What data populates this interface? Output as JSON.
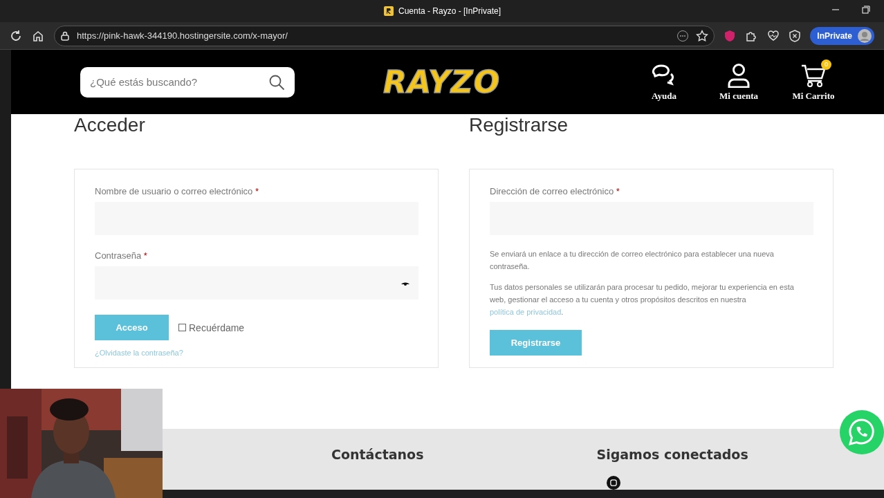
{
  "browser": {
    "tab_title": "Cuenta - Rayzo - [InPrivate]",
    "url": "https://pink-hawk-344190.hostingersite.com/x-mayor/",
    "profile_label": "InPrivate"
  },
  "header": {
    "search_placeholder": "¿Qué estás buscando?",
    "logo": "RAYZO",
    "nav": [
      {
        "label": "Ayuda",
        "kind": "chat"
      },
      {
        "label": "Mi cuenta",
        "kind": "user"
      },
      {
        "label": "Mi Carrito",
        "kind": "cart",
        "badge": "0"
      }
    ]
  },
  "login": {
    "title": "Acceder",
    "fields": [
      {
        "label": "Nombre de usuario o correo electrónico",
        "required_mark": "*",
        "kind": "text"
      },
      {
        "label": "Contraseña",
        "required_mark": "*",
        "kind": "password"
      }
    ],
    "button": "Acceso",
    "remember": {
      "label": "Recuérdame",
      "checked": false
    },
    "lost_password": "¿Olvidaste la contraseña?"
  },
  "register": {
    "title": "Registrarse",
    "fields": [
      {
        "label": "Dirección de correo electrónico",
        "required_mark": "*"
      }
    ],
    "notice": "Se enviará un enlace a tu dirección de correo electrónico para establecer una nueva contraseña.",
    "privacy_text": "Tus datos personales se utilizarán para procesar tu pedido, mejorar tu experiencia en esta web, gestionar el acceso a tu cuenta y otros propósitos descritos en nuestra",
    "privacy_link": "política de privacidad",
    "privacy_end": ".",
    "button": "Registrarse"
  },
  "footer": {
    "columns": [
      {
        "title": "Contáctanos"
      },
      {
        "title": "Sigamos conectados"
      }
    ]
  }
}
